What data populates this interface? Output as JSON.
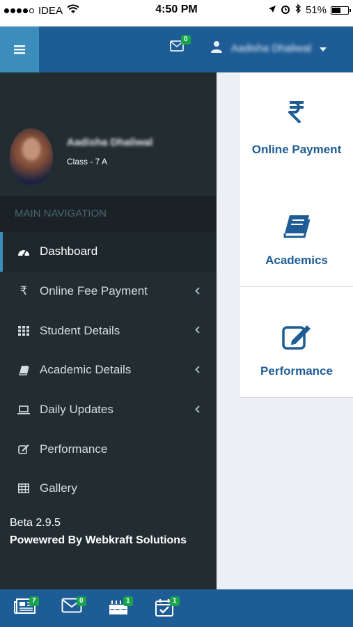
{
  "status_bar": {
    "carrier": "IDEA",
    "time": "4:50 PM",
    "battery_percent": "51%",
    "battery_level": 0.51
  },
  "header": {
    "menu_icon": "hamburger-icon",
    "mail_count": "0",
    "user_name": "Aadisha Dhaliwal"
  },
  "profile": {
    "name": "Aadisha Dhaliwal",
    "class_label": "Class - 7 A"
  },
  "sidebar": {
    "section_title": "MAIN NAVIGATION",
    "items": [
      {
        "label": "Dashboard",
        "icon": "dashboard-icon",
        "active": true,
        "has_submenu": false
      },
      {
        "label": "Online Fee Payment",
        "icon": "rupee-icon",
        "active": false,
        "has_submenu": true
      },
      {
        "label": "Student Details",
        "icon": "grid-icon",
        "active": false,
        "has_submenu": true
      },
      {
        "label": "Academic Details",
        "icon": "book-icon",
        "active": false,
        "has_submenu": true
      },
      {
        "label": "Daily Updates",
        "icon": "laptop-icon",
        "active": false,
        "has_submenu": true
      },
      {
        "label": "Performance",
        "icon": "edit-icon",
        "active": false,
        "has_submenu": false
      },
      {
        "label": "Gallery",
        "icon": "table-icon",
        "active": false,
        "has_submenu": false
      }
    ],
    "version": "Beta 2.9.5",
    "powered_by": "Powewred By Webkraft Solutions"
  },
  "cards": [
    {
      "label": "Online Payment",
      "icon": "rupee-icon"
    },
    {
      "label": "Academics",
      "icon": "book-icon"
    },
    {
      "label": "Performance",
      "icon": "edit-icon"
    }
  ],
  "bottom_bar": [
    {
      "icon": "newspaper-icon",
      "count": "7"
    },
    {
      "icon": "envelope-icon",
      "count": "0"
    },
    {
      "icon": "birthday-cake-icon",
      "count": "1"
    },
    {
      "icon": "calendar-check-icon",
      "count": "1"
    }
  ],
  "colors": {
    "header_bg": "#1e5c96",
    "menu_button_bg": "#3c8dbc",
    "sidebar_bg": "#222d32",
    "badge_green": "#19a34a",
    "card_text": "#1e5c96"
  }
}
